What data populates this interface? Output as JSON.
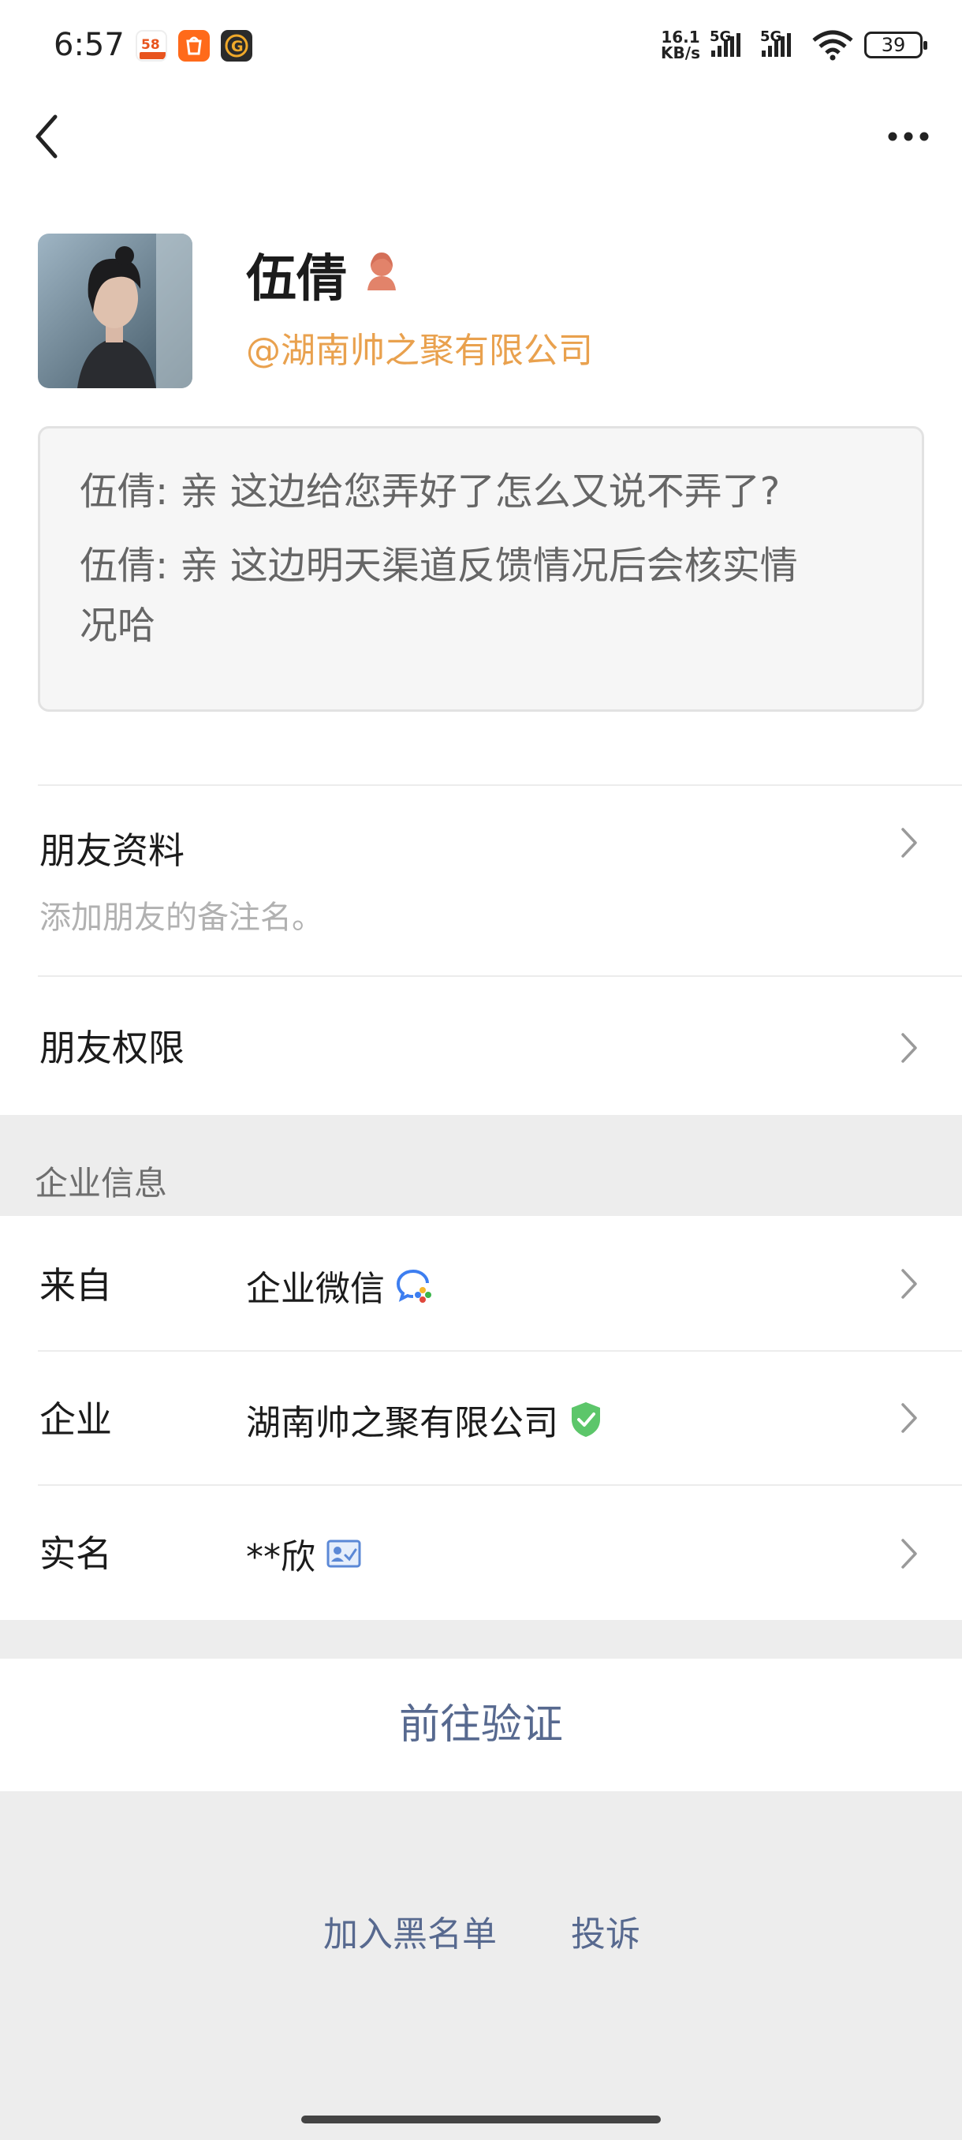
{
  "status_bar": {
    "time": "6:57",
    "net_speed_top": "16.1",
    "net_speed_bottom": "KB/s",
    "sim1_label": "5G",
    "sim2_label": "5G",
    "battery": "39",
    "notification_icons": [
      "58-app-icon",
      "taobao-app-icon",
      "g-app-icon"
    ]
  },
  "nav": {
    "back_icon": "chevron-left-icon",
    "more_icon": "more-dots-icon"
  },
  "profile": {
    "name": "伍倩",
    "gender_icon": "female-icon",
    "company_link": "@湖南帅之聚有限公司",
    "accent_color": "#e9a14e"
  },
  "messages": [
    {
      "line1": "伍倩: 亲 这边给您弄好了怎么又说不弄了?",
      "line2": ""
    },
    {
      "line1": "伍倩: 亲 这边明天渠道反馈情况后会核实情",
      "line2": "况哈"
    }
  ],
  "friend_profile": {
    "title": "朋友资料",
    "subtitle": "添加朋友的备注名。"
  },
  "friend_permissions": {
    "title": "朋友权限"
  },
  "enterprise_section": {
    "label": "企业信息",
    "rows": [
      {
        "label": "来自",
        "value": "企业微信",
        "icon": "wecom-icon"
      },
      {
        "label": "企业",
        "value": "湖南帅之聚有限公司",
        "icon": "verified-shield-icon"
      },
      {
        "label": "实名",
        "value": "**欣",
        "icon": "id-card-icon"
      }
    ]
  },
  "verify_button": "前往验证",
  "footer_links": {
    "blacklist": "加入黑名单",
    "complain": "投诉",
    "link_color": "#57698f"
  }
}
